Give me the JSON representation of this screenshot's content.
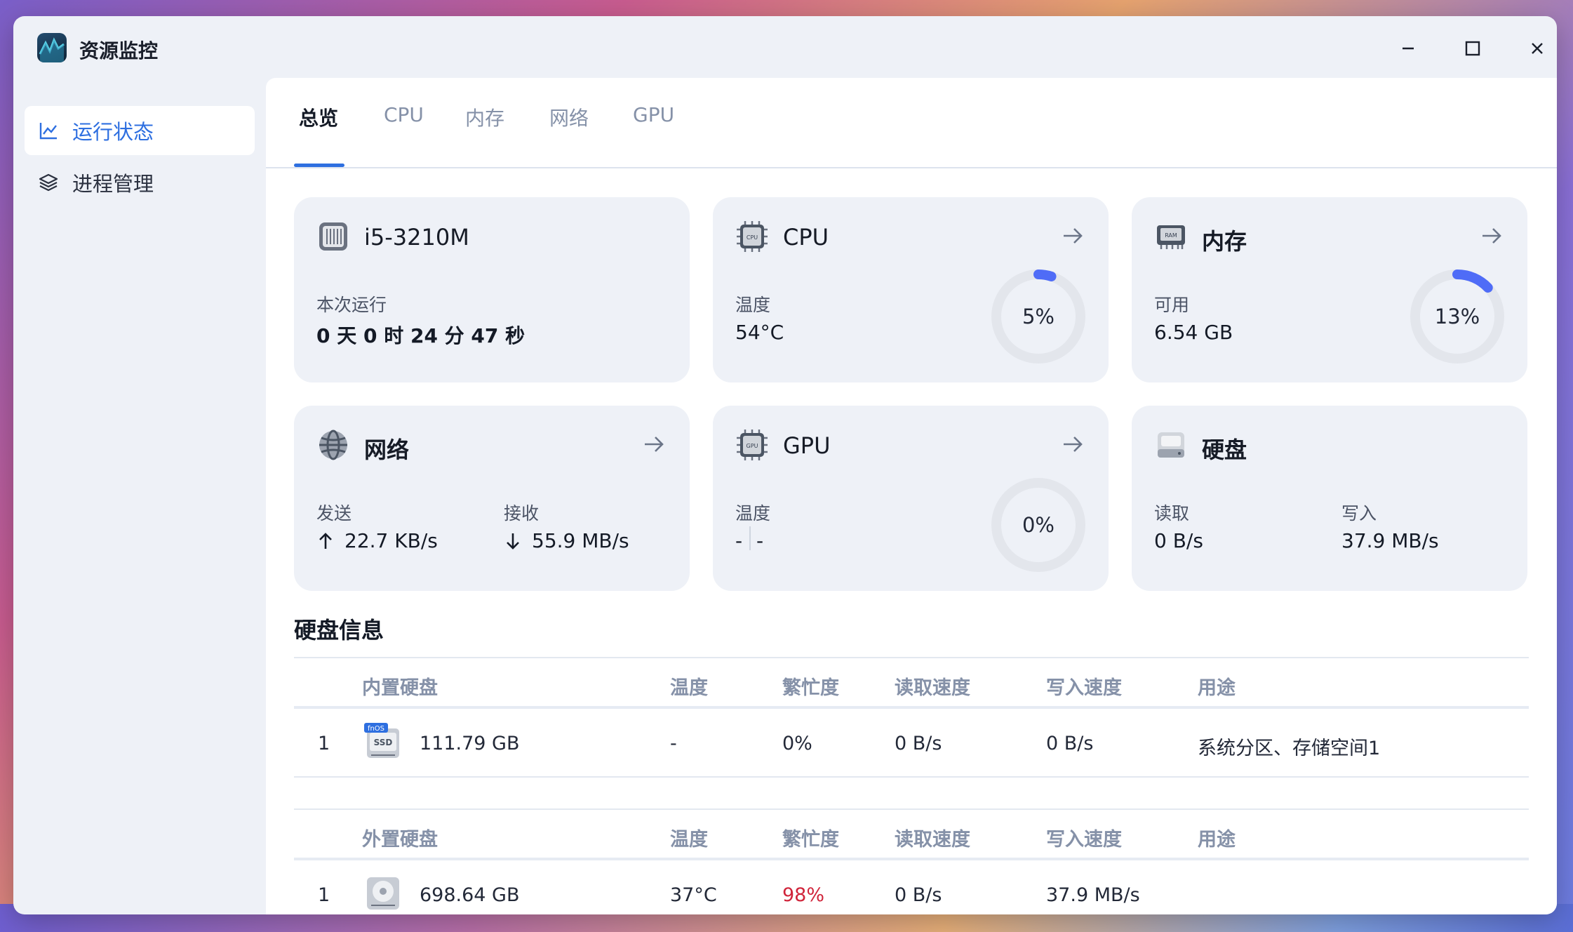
{
  "app": {
    "title": "资源监控"
  },
  "sidebar": {
    "items": [
      {
        "label": "运行状态",
        "icon": "chart-line-icon",
        "active": true
      },
      {
        "label": "进程管理",
        "icon": "layers-icon",
        "active": false
      }
    ]
  },
  "tabs": [
    {
      "label": "总览",
      "active": true
    },
    {
      "label": "CPU"
    },
    {
      "label": "内存"
    },
    {
      "label": "网络"
    },
    {
      "label": "GPU"
    }
  ],
  "cards": {
    "system": {
      "title": "i5-3210M",
      "uptime_label": "本次运行",
      "uptime_value": "0 天 0 时 24 分 47 秒"
    },
    "cpu": {
      "title": "CPU",
      "temp_label": "温度",
      "temp_value": "54°C",
      "usage_text": "5%",
      "usage": 5
    },
    "memory": {
      "title": "内存",
      "avail_label": "可用",
      "avail_value": "6.54 GB",
      "usage_text": "13%",
      "usage": 13
    },
    "network": {
      "title": "网络",
      "send_label": "发送",
      "send_value": "22.7 KB/s",
      "recv_label": "接收",
      "recv_value": "55.9 MB/s"
    },
    "gpu": {
      "title": "GPU",
      "temp_label": "温度",
      "temp_value": "-",
      "temp_value2": "-",
      "usage_text": "0%",
      "usage": 0
    },
    "disk": {
      "title": "硬盘",
      "read_label": "读取",
      "read_value": "0 B/s",
      "write_label": "写入",
      "write_value": "37.9 MB/s"
    }
  },
  "disk_info": {
    "title": "硬盘信息",
    "internal": {
      "headers": [
        "内置硬盘",
        "温度",
        "繁忙度",
        "读取速度",
        "写入速度",
        "用途"
      ],
      "rows": [
        {
          "index": "1",
          "size": "111.79 GB",
          "temp": "-",
          "busy": "0%",
          "read": "0 B/s",
          "write": "0 B/s",
          "usage": "系统分区、存储空间1",
          "badge": "fnOS",
          "badge2": "SSD"
        }
      ]
    },
    "external": {
      "headers": [
        "外置硬盘",
        "温度",
        "繁忙度",
        "读取速度",
        "写入速度",
        "用途"
      ],
      "rows": [
        {
          "index": "1",
          "size": "698.64 GB",
          "temp": "37°C",
          "busy": "98%",
          "read": "0 B/s",
          "write": "37.9 MB/s",
          "usage": ""
        }
      ]
    }
  },
  "colors": {
    "accent": "#2e6fe0",
    "gauge": "#4f6cf7",
    "danger": "#d0243a"
  }
}
